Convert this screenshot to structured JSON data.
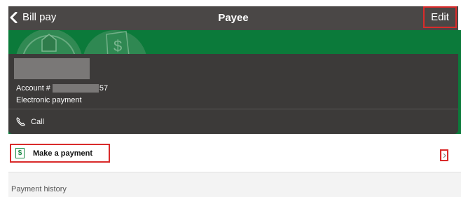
{
  "header": {
    "back_label": "Bill pay",
    "title": "Payee",
    "edit_label": "Edit"
  },
  "payee": {
    "account_prefix": "Account #",
    "account_suffix": "57",
    "payment_type": "Electronic payment",
    "call_label": "Call"
  },
  "actions": {
    "make_payment_label": "Make a payment",
    "dollar_glyph": "$"
  },
  "sections": {
    "payment_history_label": "Payment history"
  },
  "icons": {
    "back": "chevron-left-icon",
    "phone": "phone-icon",
    "money": "dollar-icon",
    "forward": "chevron-right-icon"
  },
  "colors": {
    "header_bg": "#4a4746",
    "brand_green": "#0b7a3a",
    "card_bg": "#3c3a39",
    "highlight_red": "#d92b2b",
    "icon_green": "#1a8a46"
  }
}
